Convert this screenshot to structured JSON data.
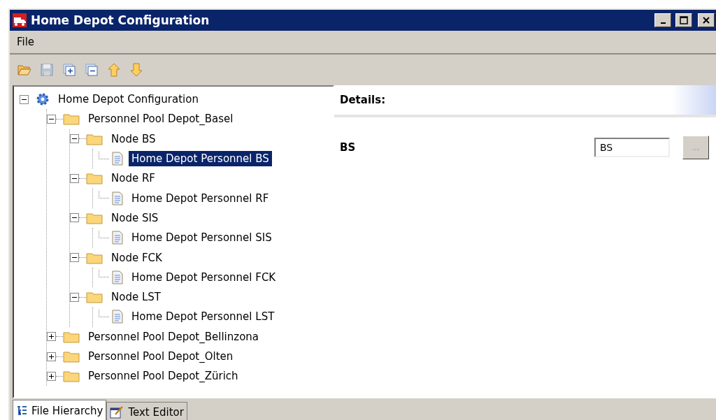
{
  "window": {
    "title": "Home Depot Configuration"
  },
  "menu": [
    "File"
  ],
  "toolbar": [
    {
      "kind": "open"
    },
    {
      "kind": "save",
      "disabled": true
    },
    {
      "kind": "expand-all"
    },
    {
      "kind": "collapse-all"
    },
    {
      "kind": "up"
    },
    {
      "kind": "down"
    }
  ],
  "tree": [
    {
      "label": "Home Depot Configuration",
      "kind": "root",
      "expanded": true,
      "selected": false,
      "children": [
        {
          "label": "Personnel Pool Depot_Basel",
          "kind": "folder",
          "expanded": true,
          "selected": false,
          "children": [
            {
              "label": "Node BS",
              "kind": "folder",
              "expanded": true,
              "selected": false,
              "children": [
                {
                  "label": "Home Depot Personnel BS",
                  "kind": "document",
                  "selected": true
                }
              ]
            },
            {
              "label": "Node RF",
              "kind": "folder",
              "expanded": true,
              "selected": false,
              "children": [
                {
                  "label": "Home Depot Personnel RF",
                  "kind": "document",
                  "selected": false
                }
              ]
            },
            {
              "label": "Node SIS",
              "kind": "folder",
              "expanded": true,
              "selected": false,
              "children": [
                {
                  "label": "Home Depot Personnel SIS",
                  "kind": "document",
                  "selected": false
                }
              ]
            },
            {
              "label": "Node FCK",
              "kind": "folder",
              "expanded": true,
              "selected": false,
              "children": [
                {
                  "label": "Home Depot Personnel FCK",
                  "kind": "document",
                  "selected": false
                }
              ]
            },
            {
              "label": "Node LST",
              "kind": "folder",
              "expanded": true,
              "selected": false,
              "children": [
                {
                  "label": "Home Depot Personnel LST",
                  "kind": "document",
                  "selected": false
                }
              ]
            }
          ]
        },
        {
          "label": "Personnel Pool Depot_Bellinzona",
          "kind": "folder",
          "expanded": false,
          "selected": false
        },
        {
          "label": "Personnel Pool Depot_Olten",
          "kind": "folder",
          "expanded": false,
          "selected": false
        },
        {
          "label": "Personnel Pool Depot_Zürich",
          "kind": "folder",
          "expanded": false,
          "selected": false
        }
      ]
    }
  ],
  "details": {
    "title": "Details:",
    "field": {
      "label": "BS",
      "value": "BS",
      "button": "..."
    }
  },
  "tabs": [
    {
      "label": "File Hierarchy",
      "kind": "hierarchy",
      "selected": true
    },
    {
      "label": "Text Editor",
      "kind": "editor",
      "selected": false
    }
  ]
}
